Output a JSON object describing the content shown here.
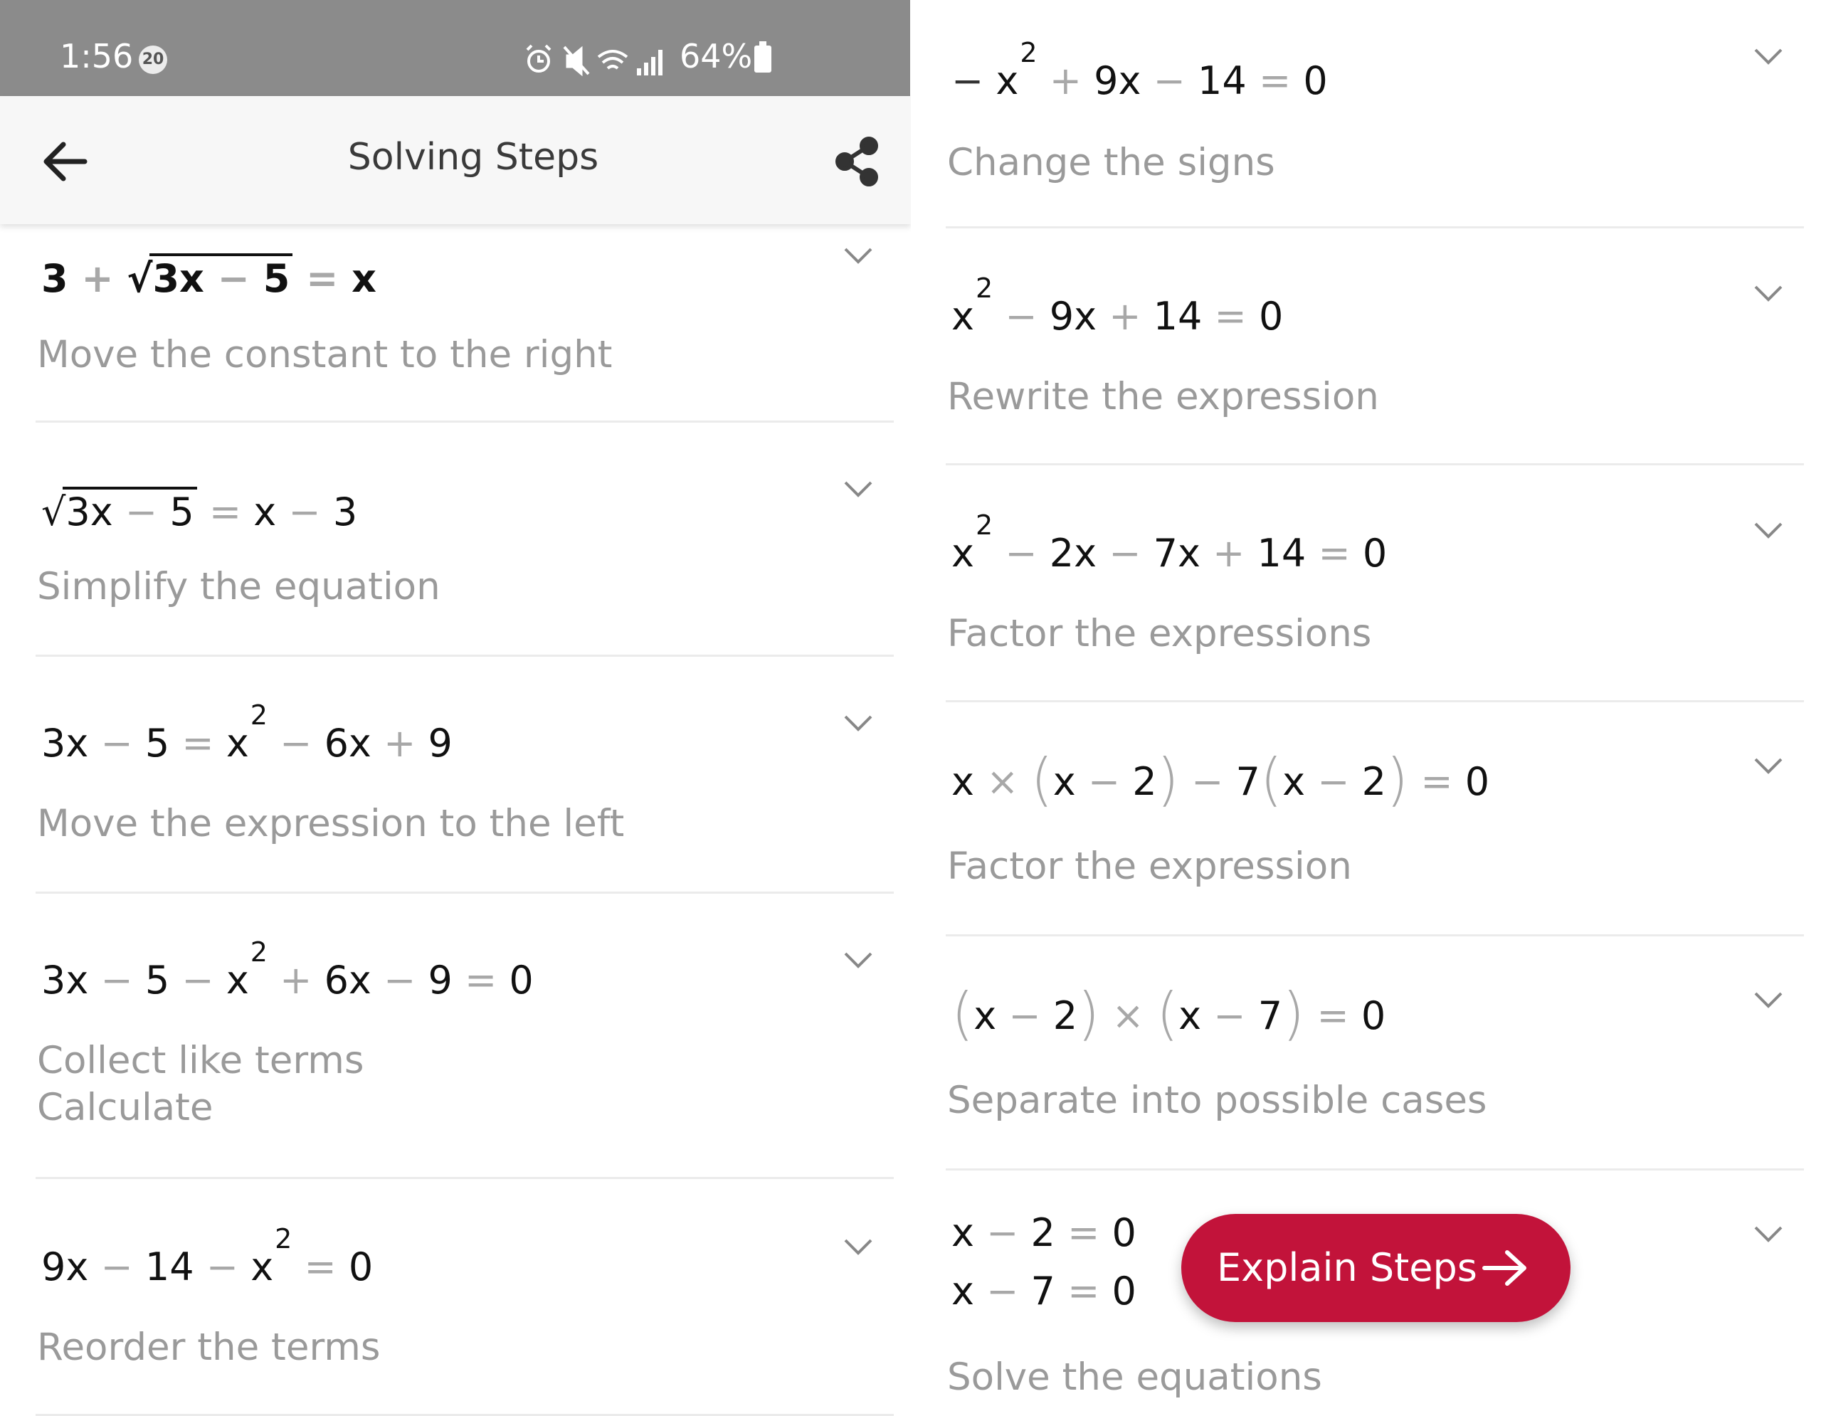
{
  "status_bar": {
    "time": "1:56",
    "notification_count": "20",
    "battery_percent": "64%",
    "background": "#8b8b8b"
  },
  "app_bar": {
    "title": "Solving Steps"
  },
  "accent_color": "#c2133a",
  "left_steps": [
    {
      "equation": "3 + √(3x − 5) = x",
      "description": "Move the constant to the right"
    },
    {
      "equation": "√(3x − 5) = x − 3",
      "description": "Simplify the equation"
    },
    {
      "equation": "3x − 5 = x² − 6x + 9",
      "description": "Move the expression to the left"
    },
    {
      "equation": "3x − 5 − x² + 6x − 9 = 0",
      "description_line1": "Collect like terms",
      "description_line2": "Calculate"
    },
    {
      "equation": "9x − 14 − x² = 0",
      "description": "Reorder the terms"
    }
  ],
  "right_steps": [
    {
      "equation": "− x² + 9x − 14 = 0",
      "description": "Change the signs"
    },
    {
      "equation": "x² − 9x + 14 = 0",
      "description": "Rewrite the expression"
    },
    {
      "equation": "x² − 2x − 7x + 14 = 0",
      "description": "Factor the expressions"
    },
    {
      "equation": "x × (x − 2) − 7(x − 2) = 0",
      "description": "Factor the expression"
    },
    {
      "equation": "(x − 2) × (x − 7) = 0",
      "description": "Separate into possible cases"
    },
    {
      "equation_line1": "x − 2 = 0",
      "equation_line2": "x − 7 = 0",
      "description": "Solve the equations"
    }
  ],
  "explain_button": {
    "label": "Explain Steps"
  }
}
